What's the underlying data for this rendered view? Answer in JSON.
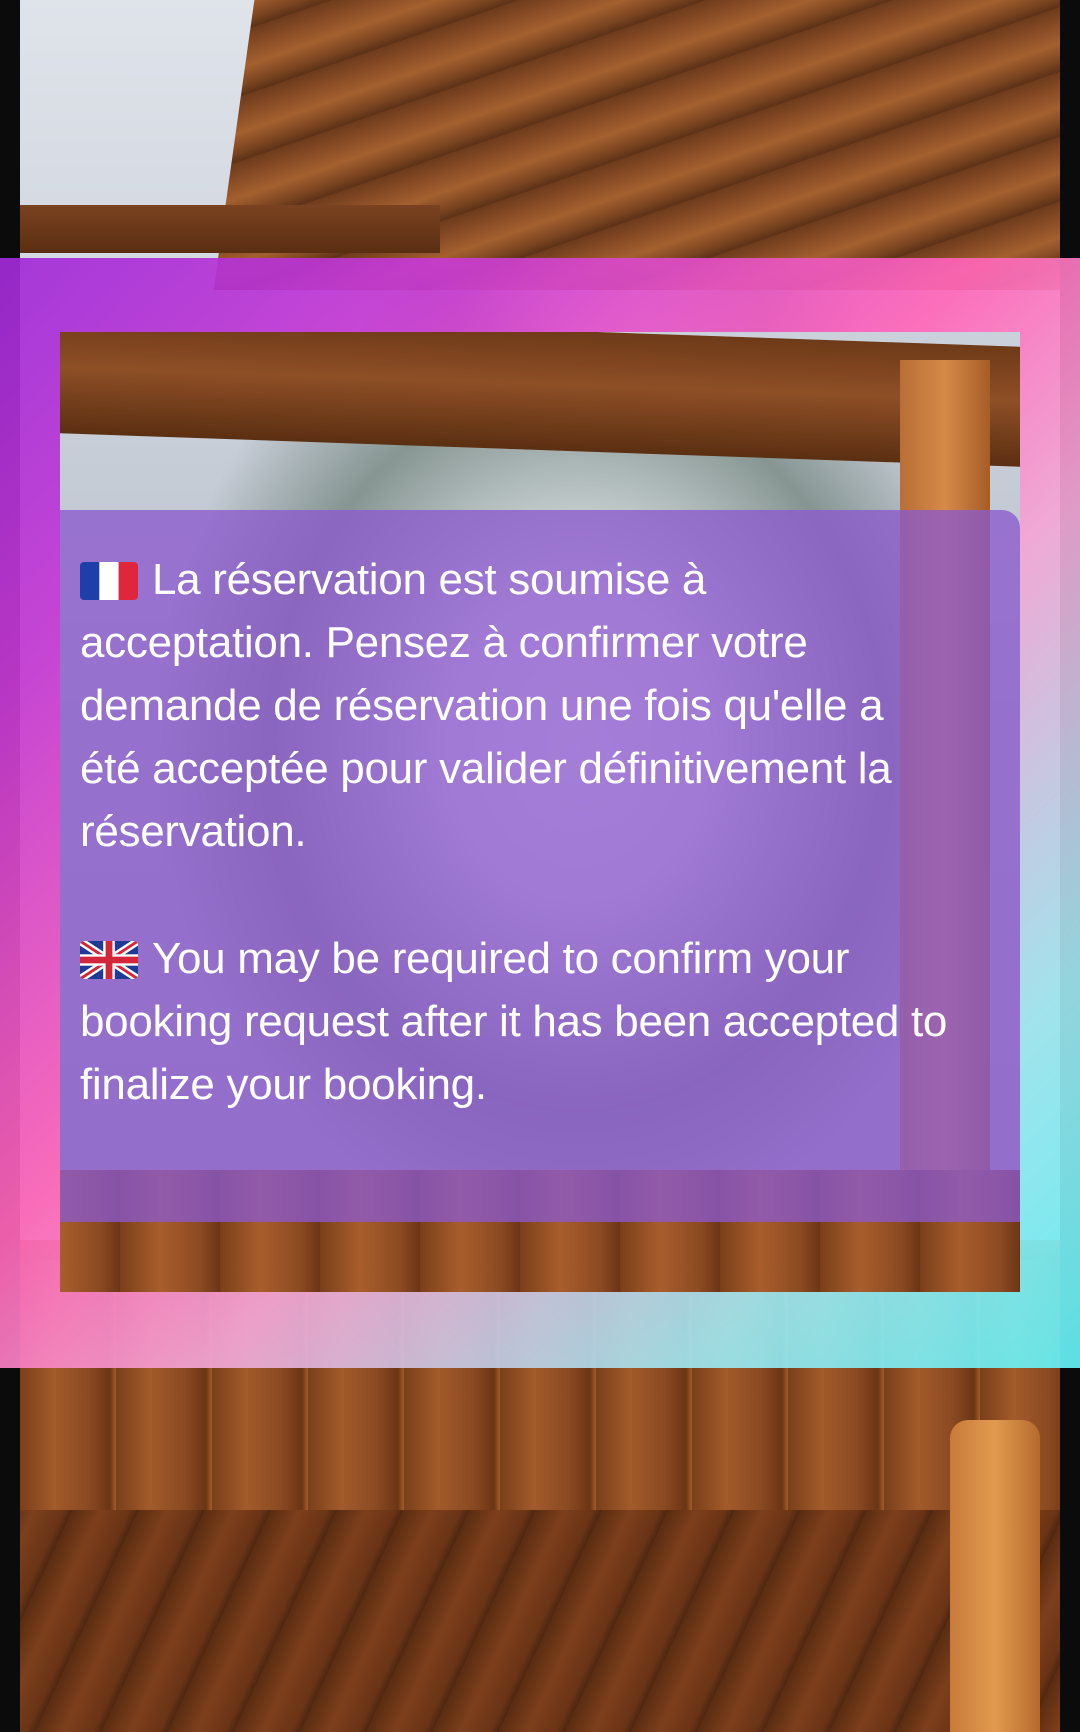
{
  "messages": {
    "french": {
      "flag": "france-flag-icon",
      "text": "La réservation est soumise à acceptation. Pensez à confirmer votre demande de réservation une fois qu'elle a été acceptée pour valider définitivement la réservation."
    },
    "english": {
      "flag": "uk-flag-icon",
      "text": "You may be required to confirm your booking request after it has been accepted to finalize your booking."
    }
  },
  "colors": {
    "frame_gradient": [
      "#a02ad8",
      "#ff66b8",
      "#63f2f6"
    ],
    "card_background": "#8c5acd",
    "text": "#ffffff"
  }
}
